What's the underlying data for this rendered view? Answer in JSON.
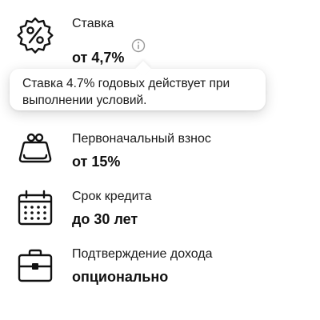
{
  "rate": {
    "label": "Ставка",
    "value": "от 4,7%",
    "icon": "percent-badge-icon",
    "info_icon": "info-icon"
  },
  "tooltip": {
    "text": "Ставка 4.7% годовых действует при выполнении условий."
  },
  "down_payment": {
    "label": "Первоначальный взнос",
    "value": "от 15%",
    "icon": "wallet-purse-icon"
  },
  "term": {
    "label": "Срок кредита",
    "value": "до 30 лет",
    "icon": "calendar-icon"
  },
  "income": {
    "label": "Подтверждение дохода",
    "value": "опционально",
    "icon": "briefcase-icon"
  },
  "colors": {
    "text": "#111111",
    "muted_icon": "#9a9a9a",
    "background": "#ffffff"
  }
}
